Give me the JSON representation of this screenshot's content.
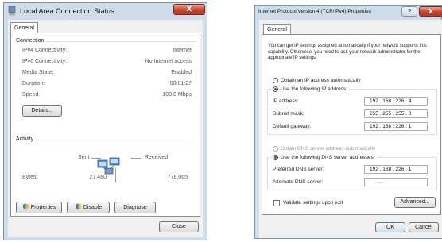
{
  "status_dialog": {
    "title": "Local Area Connection Status",
    "close_label": "X",
    "tab": "General",
    "connection": {
      "heading": "Connection",
      "rows": [
        {
          "label": "IPv4 Connectivity:",
          "value": "Internet"
        },
        {
          "label": "IPv6 Connectivity:",
          "value": "No Internet access"
        },
        {
          "label": "Media State:",
          "value": "Enabled"
        },
        {
          "label": "Duration:",
          "value": "00:01:27"
        },
        {
          "label": "Speed:",
          "value": "100.0 Mbps"
        }
      ],
      "details_button": "Details..."
    },
    "activity": {
      "heading": "Activity",
      "sent_label": "Sent",
      "received_label": "Received",
      "bytes_label": "Bytes:",
      "bytes_sent": "27,480",
      "bytes_received": "778,065"
    },
    "buttons": {
      "properties": "Properties",
      "disable": "Disable",
      "diagnose": "Diagnose",
      "close": "Close"
    }
  },
  "ipv4_dialog": {
    "title": "Internet Protocol Version 4 (TCP/IPv4) Properties",
    "help_label": "?",
    "close_label": "X",
    "tab": "General",
    "description": "You can get IP settings assigned automatically if your network supports this capability. Otherwise, you need to ask your network administrator for the appropriate IP settings.",
    "obtain_ip_auto": "Obtain an IP address automatically",
    "use_following_ip": "Use the following IP address:",
    "ip_address_label": "IP address:",
    "ip_address_value": "192 . 168 . 226 . 4",
    "subnet_mask_label": "Subnet mask:",
    "subnet_mask_value": "255 . 255 . 255 . 0",
    "gateway_label": "Default gateway:",
    "gateway_value": "192 . 168 . 226 . 1",
    "obtain_dns_auto": "Obtain DNS server address automatically",
    "use_following_dns": "Use the following DNS server addresses:",
    "preferred_dns_label": "Preferred DNS server:",
    "preferred_dns_value": "192 . 168 . 226 . 1",
    "alternate_dns_label": "Alternate DNS server:",
    "alternate_dns_value": ".       .       .",
    "validate_label": "Validate settings upon exit",
    "advanced_button": "Advanced...",
    "ok_button": "OK",
    "cancel_button": "Cancel"
  }
}
